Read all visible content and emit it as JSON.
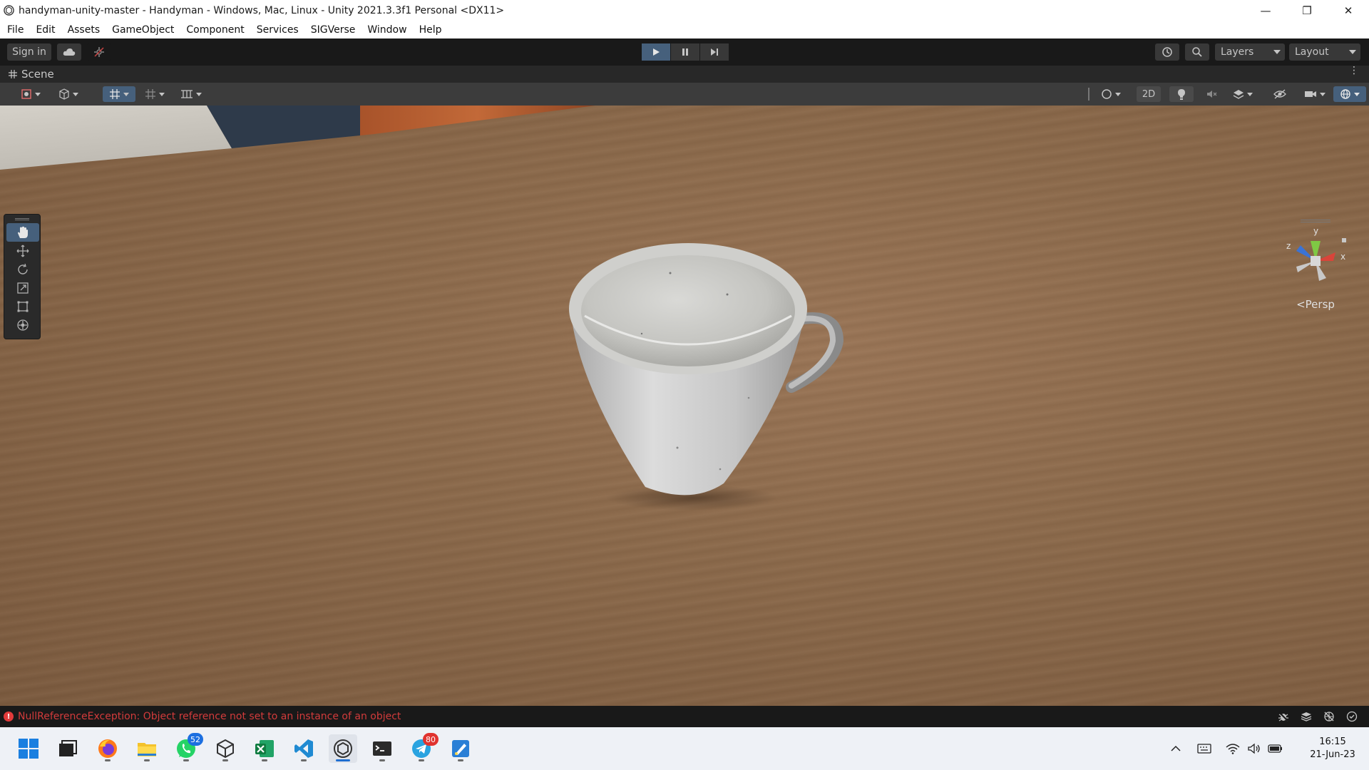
{
  "window": {
    "title": "handyman-unity-master - Handyman - Windows, Mac, Linux - Unity 2021.3.3f1 Personal <DX11>"
  },
  "menu": {
    "items": [
      "File",
      "Edit",
      "Assets",
      "GameObject",
      "Component",
      "Services",
      "SIGVerse",
      "Window",
      "Help"
    ]
  },
  "toolbar": {
    "sign_in_label": "Sign in",
    "layers_label": "Layers",
    "layout_label": "Layout"
  },
  "scene": {
    "tab_label": "Scene",
    "toggle_2d_label": "2D",
    "persp_label": "Persp",
    "gizmo_axes": {
      "y": "y",
      "x": "x",
      "z": "z"
    }
  },
  "status": {
    "error_message": "NullReferenceException: Object reference not set to an instance of an object"
  },
  "taskbar": {
    "whatsapp_badge": "52",
    "telegram_badge": "80",
    "clock_time": "16:15",
    "clock_date": "21-Jun-23"
  },
  "colors": {
    "accent_blue": "#46607c",
    "error_red": "#d33b3b",
    "toolbar_bg": "#191919"
  }
}
